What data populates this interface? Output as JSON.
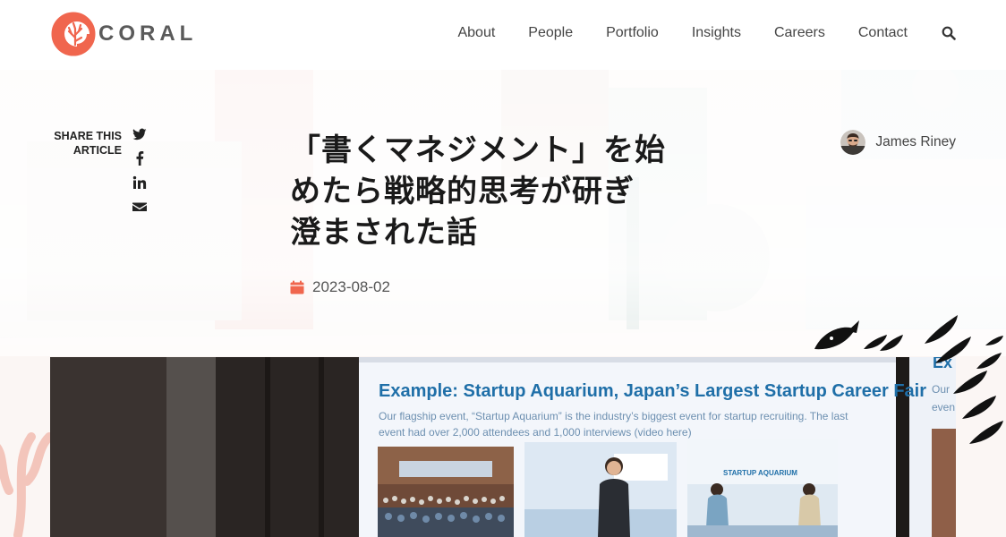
{
  "brand": {
    "logo_text": "CORAL",
    "accent_color": "#f0664e"
  },
  "nav": {
    "items": [
      {
        "label": "About"
      },
      {
        "label": "People"
      },
      {
        "label": "Portfolio"
      },
      {
        "label": "Insights"
      },
      {
        "label": "Careers"
      },
      {
        "label": "Contact"
      }
    ],
    "search_icon": "search-icon"
  },
  "share": {
    "label_line1": "SHARE THIS",
    "label_line2": "ARTICLE",
    "icons": [
      "twitter-icon",
      "facebook-icon",
      "linkedin-icon",
      "email-icon"
    ]
  },
  "article": {
    "title_line1": "「書くマネジメント」を始",
    "title_line2": "めたら戦略的思考が研ぎ",
    "title_line3": "澄まされた話",
    "date": "2023-08-02",
    "date_icon": "calendar-icon",
    "author": {
      "name": "James Riney"
    }
  },
  "feature_image": {
    "slide_title": "Example: Startup Aquarium, Japan’s Largest Startup Career Fair",
    "slide_body_line1": "Our flagship event, “Startup Aquarium” is the industry’s biggest event for startup recruiting. The last",
    "slide_body_line2": "event had over 2,000 attendees and 1,000 interviews (video here)",
    "side_slide_title": "Ex",
    "side_slide_body_line1": "Our",
    "side_slide_body_line2": "even",
    "banner_text": "STARTUP AQUARIUM"
  }
}
